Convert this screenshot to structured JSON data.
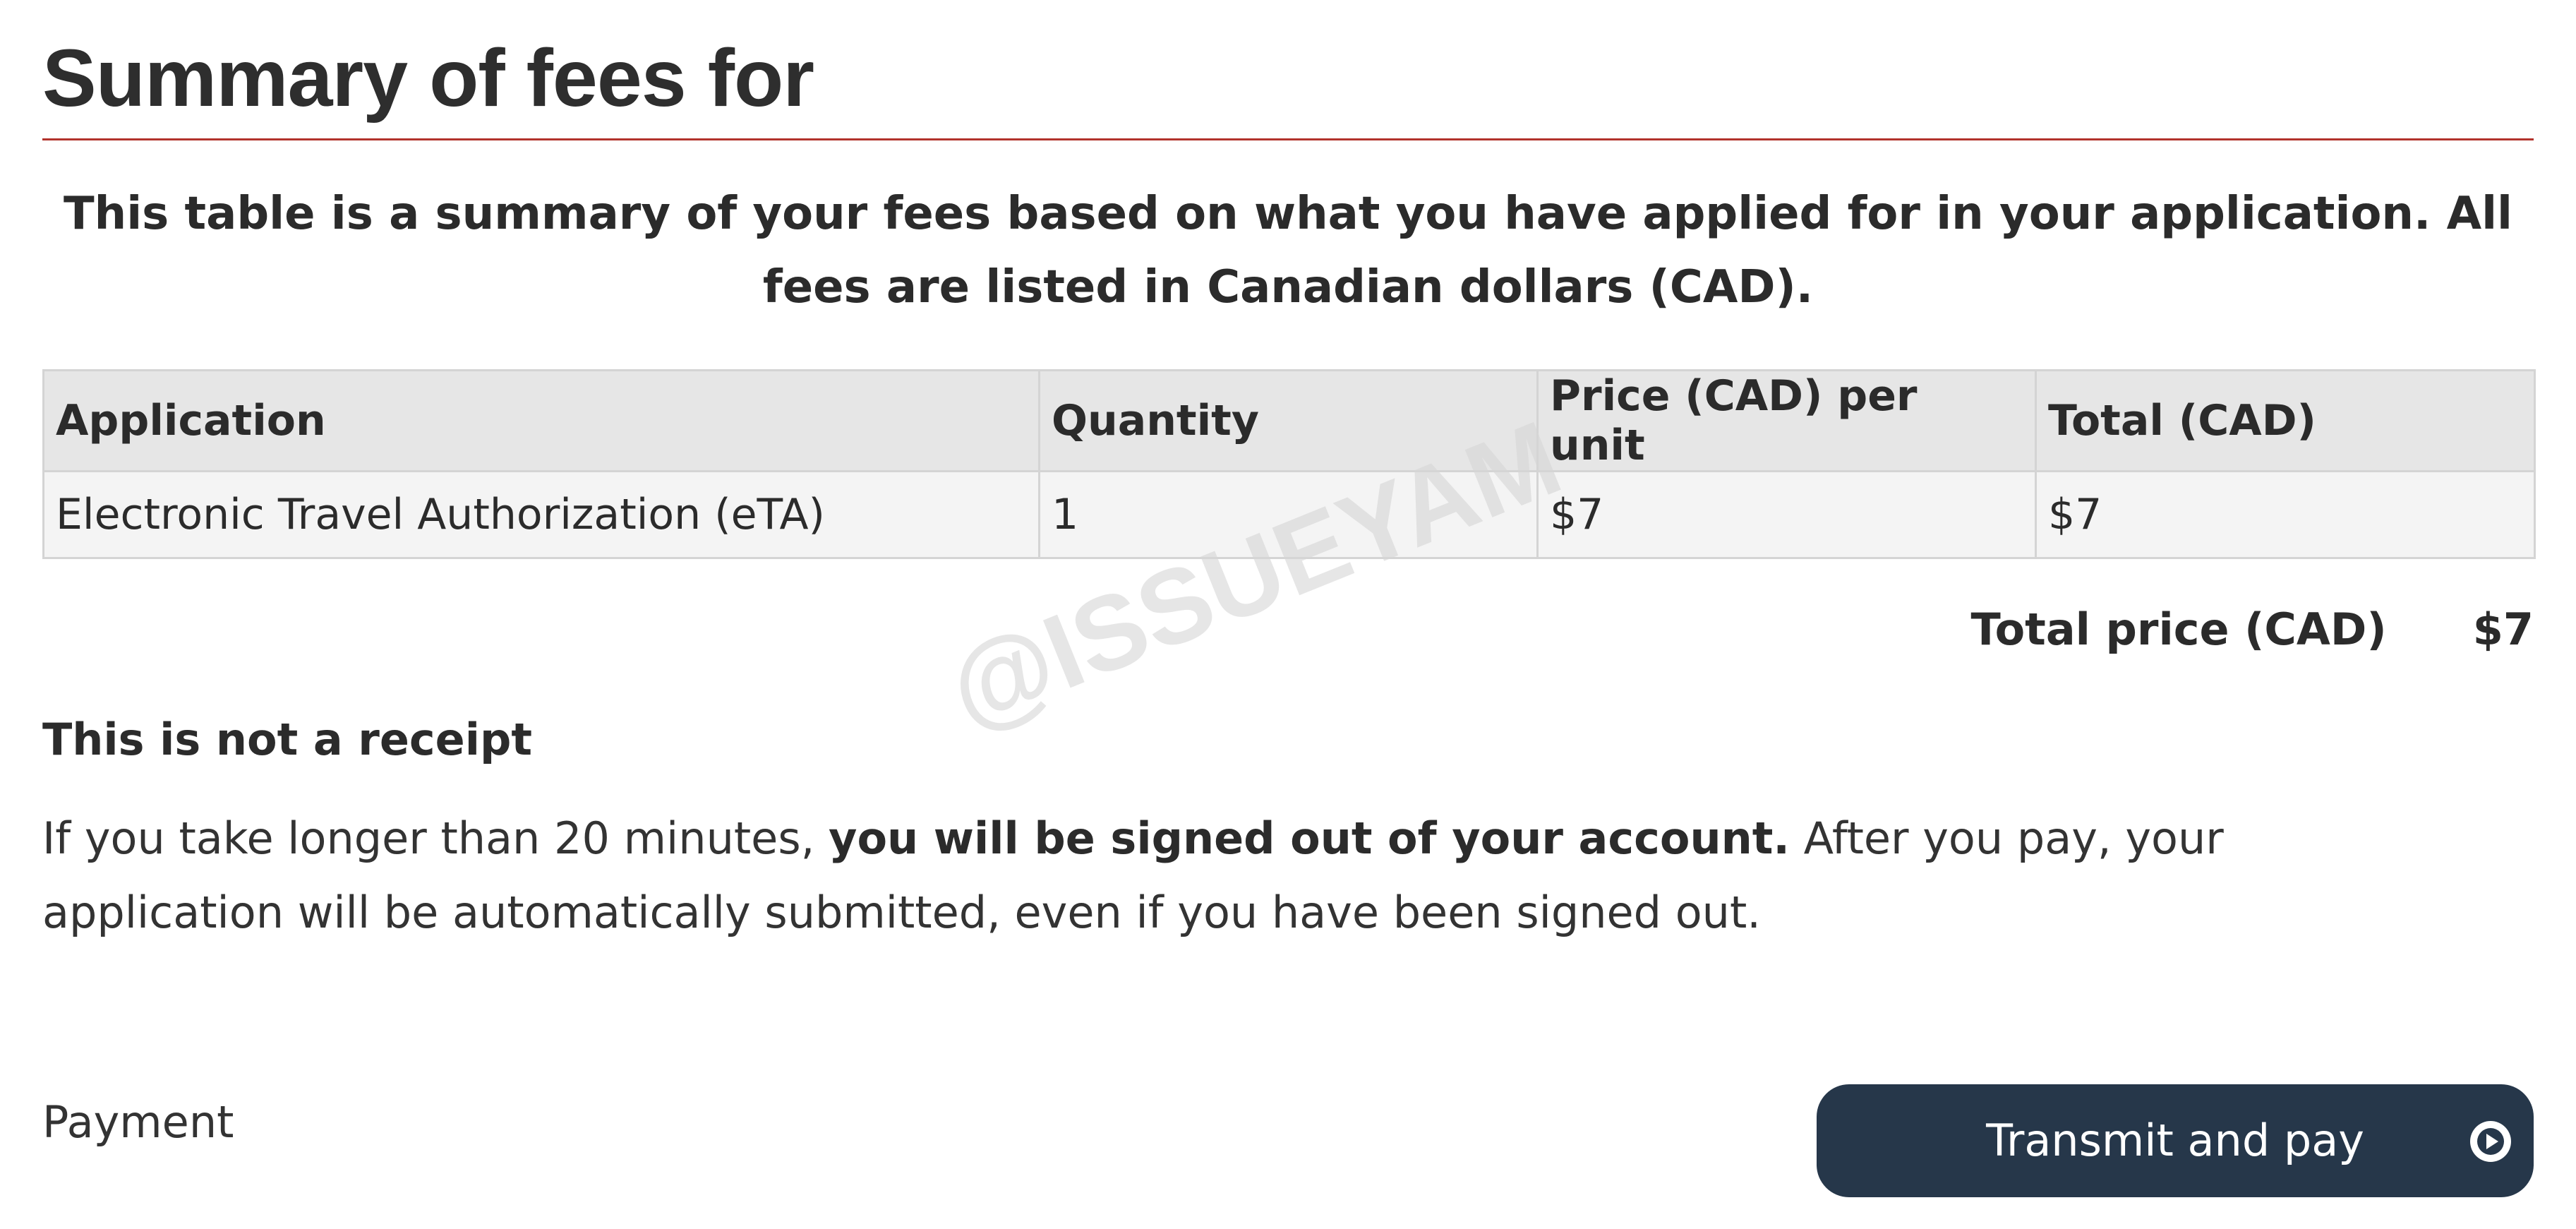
{
  "header": {
    "title": "Summary of fees for"
  },
  "intro": {
    "text": "This table is a summary of your fees based on what you have applied for in your application. All fees are listed in Canadian dollars (CAD)."
  },
  "fees_table": {
    "columns": [
      "Application",
      "Quantity",
      "Price (CAD) per unit",
      "Total (CAD)"
    ],
    "rows": [
      [
        "Electronic Travel Authorization (eTA)",
        "1",
        "$7",
        "$7"
      ]
    ]
  },
  "total": {
    "label": "Total price (CAD)",
    "value": "$7"
  },
  "notice": {
    "heading": "This is not a receipt",
    "text_before": "If you take longer than 20 minutes, ",
    "text_bold": "you will be signed out of your account.",
    "text_after": " After you pay, your application will be automatically submitted, even if you have been signed out."
  },
  "payment": {
    "label": "Payment",
    "button_label": "Transmit and pay",
    "button_icon": "play-circle-icon",
    "button_color": "#26374a"
  },
  "watermark": {
    "text": "@ISSUEYAM"
  },
  "colors": {
    "title_rule": "#b2332c",
    "table_header_bg": "#e6e6e6",
    "table_row_bg": "#f4f4f4",
    "text": "#2b2b2b"
  }
}
